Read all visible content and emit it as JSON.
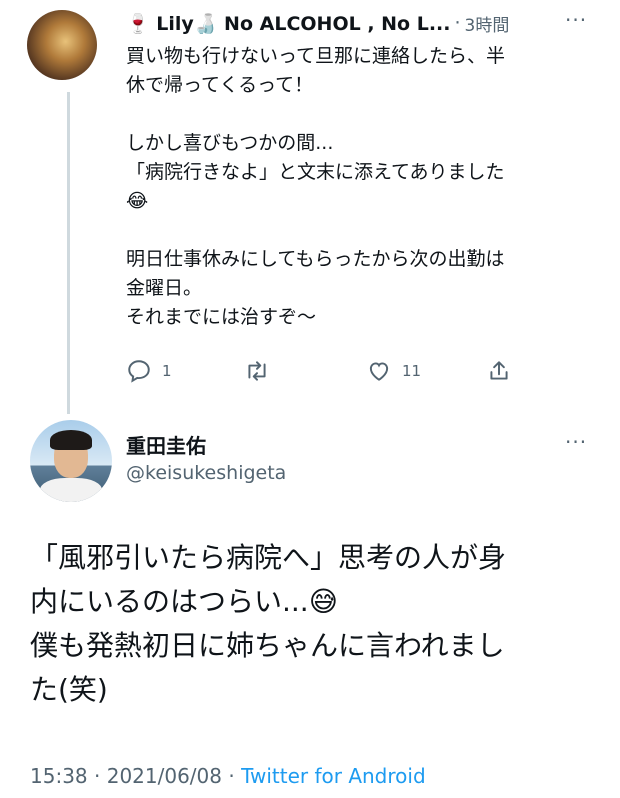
{
  "tweet1": {
    "display_name": "🍷 Lily🍶 No ALCOHOL , No L...",
    "separator": "·",
    "time": "3時間",
    "more": "···",
    "text": "買い物も行けないって旦那に連絡したら、半\n休で帰ってくるって！\n\nしかし喜びもつかの間...\n「病院行きなよ」と文末に添えてありました\n😂\n\n明日仕事休みにしてもらったから次の出勤は\n金曜日。\nそれまでには治すぞ〜",
    "reply_count": "1",
    "retweet_count": "",
    "like_count": "11"
  },
  "tweet2": {
    "display_name": "重田圭佑",
    "handle": "@keisukeshigeta",
    "more": "···",
    "text": "「風邪引いたら病院へ」思考の人が身\n内にいるのはつらい...😅\n僕も発熱初日に姉ちゃんに言われまし\nた(笑)",
    "time": "15:38",
    "separator": "·",
    "date": "2021/06/08",
    "source": "Twitter for Android"
  },
  "colors": {
    "text": "#0f1419",
    "secondary": "#536471",
    "accent": "#1d9bf0",
    "thread_line": "#cfd9de"
  },
  "icons": [
    "reply-icon",
    "retweet-icon",
    "like-icon",
    "share-icon",
    "more-icon"
  ]
}
